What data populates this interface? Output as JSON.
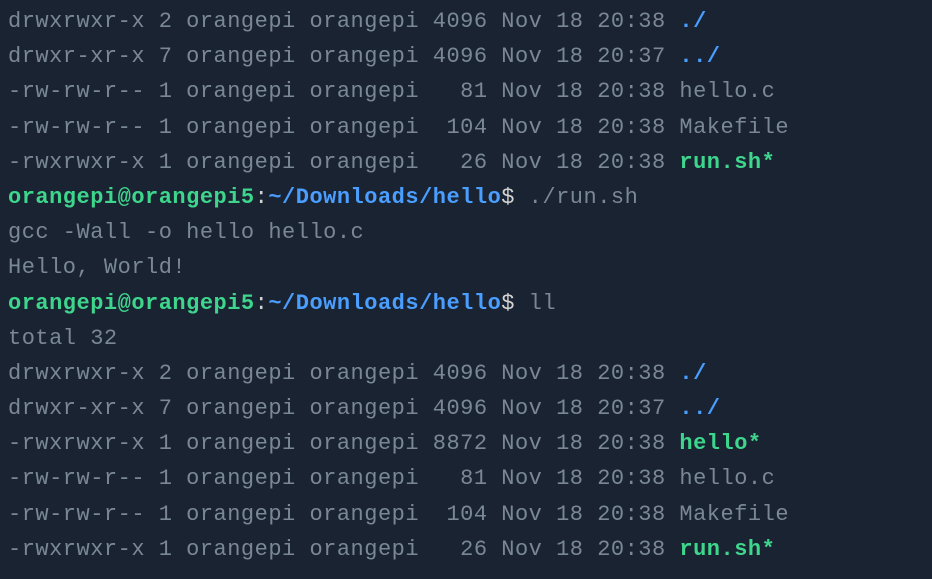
{
  "listing1": [
    {
      "perms": "drwxrwxr-x",
      "links": "2",
      "owner": "orangepi",
      "group": "orangepi",
      "size": "4096",
      "date": "Nov 18 20:38",
      "name": "./",
      "type": "dir"
    },
    {
      "perms": "drwxr-xr-x",
      "links": "7",
      "owner": "orangepi",
      "group": "orangepi",
      "size": "4096",
      "date": "Nov 18 20:37",
      "name": "../",
      "type": "dir"
    },
    {
      "perms": "-rw-rw-r--",
      "links": "1",
      "owner": "orangepi",
      "group": "orangepi",
      "size": "  81",
      "date": "Nov 18 20:38",
      "name": "hello.c",
      "type": "file"
    },
    {
      "perms": "-rw-rw-r--",
      "links": "1",
      "owner": "orangepi",
      "group": "orangepi",
      "size": " 104",
      "date": "Nov 18 20:38",
      "name": "Makefile",
      "type": "file"
    },
    {
      "perms": "-rwxrwxr-x",
      "links": "1",
      "owner": "orangepi",
      "group": "orangepi",
      "size": "  26",
      "date": "Nov 18 20:38",
      "name": "run.sh*",
      "type": "exec"
    }
  ],
  "prompt1": {
    "user_host": "orangepi@orangepi5",
    "colon": ":",
    "path": "~/Downloads/hello",
    "dollar": "$",
    "command": "./run.sh"
  },
  "output1": "gcc -Wall -o hello hello.c",
  "output2": "Hello, World!",
  "prompt2": {
    "user_host": "orangepi@orangepi5",
    "colon": ":",
    "path": "~/Downloads/hello",
    "dollar": "$",
    "command": "ll"
  },
  "total": "total 32",
  "listing2": [
    {
      "perms": "drwxrwxr-x",
      "links": "2",
      "owner": "orangepi",
      "group": "orangepi",
      "size": "4096",
      "date": "Nov 18 20:38",
      "name": "./",
      "type": "dir"
    },
    {
      "perms": "drwxr-xr-x",
      "links": "7",
      "owner": "orangepi",
      "group": "orangepi",
      "size": "4096",
      "date": "Nov 18 20:37",
      "name": "../",
      "type": "dir"
    },
    {
      "perms": "-rwxrwxr-x",
      "links": "1",
      "owner": "orangepi",
      "group": "orangepi",
      "size": "8872",
      "date": "Nov 18 20:38",
      "name": "hello*",
      "type": "exec"
    },
    {
      "perms": "-rw-rw-r--",
      "links": "1",
      "owner": "orangepi",
      "group": "orangepi",
      "size": "  81",
      "date": "Nov 18 20:38",
      "name": "hello.c",
      "type": "file"
    },
    {
      "perms": "-rw-rw-r--",
      "links": "1",
      "owner": "orangepi",
      "group": "orangepi",
      "size": " 104",
      "date": "Nov 18 20:38",
      "name": "Makefile",
      "type": "file"
    },
    {
      "perms": "-rwxrwxr-x",
      "links": "1",
      "owner": "orangepi",
      "group": "orangepi",
      "size": "  26",
      "date": "Nov 18 20:38",
      "name": "run.sh*",
      "type": "exec"
    }
  ]
}
